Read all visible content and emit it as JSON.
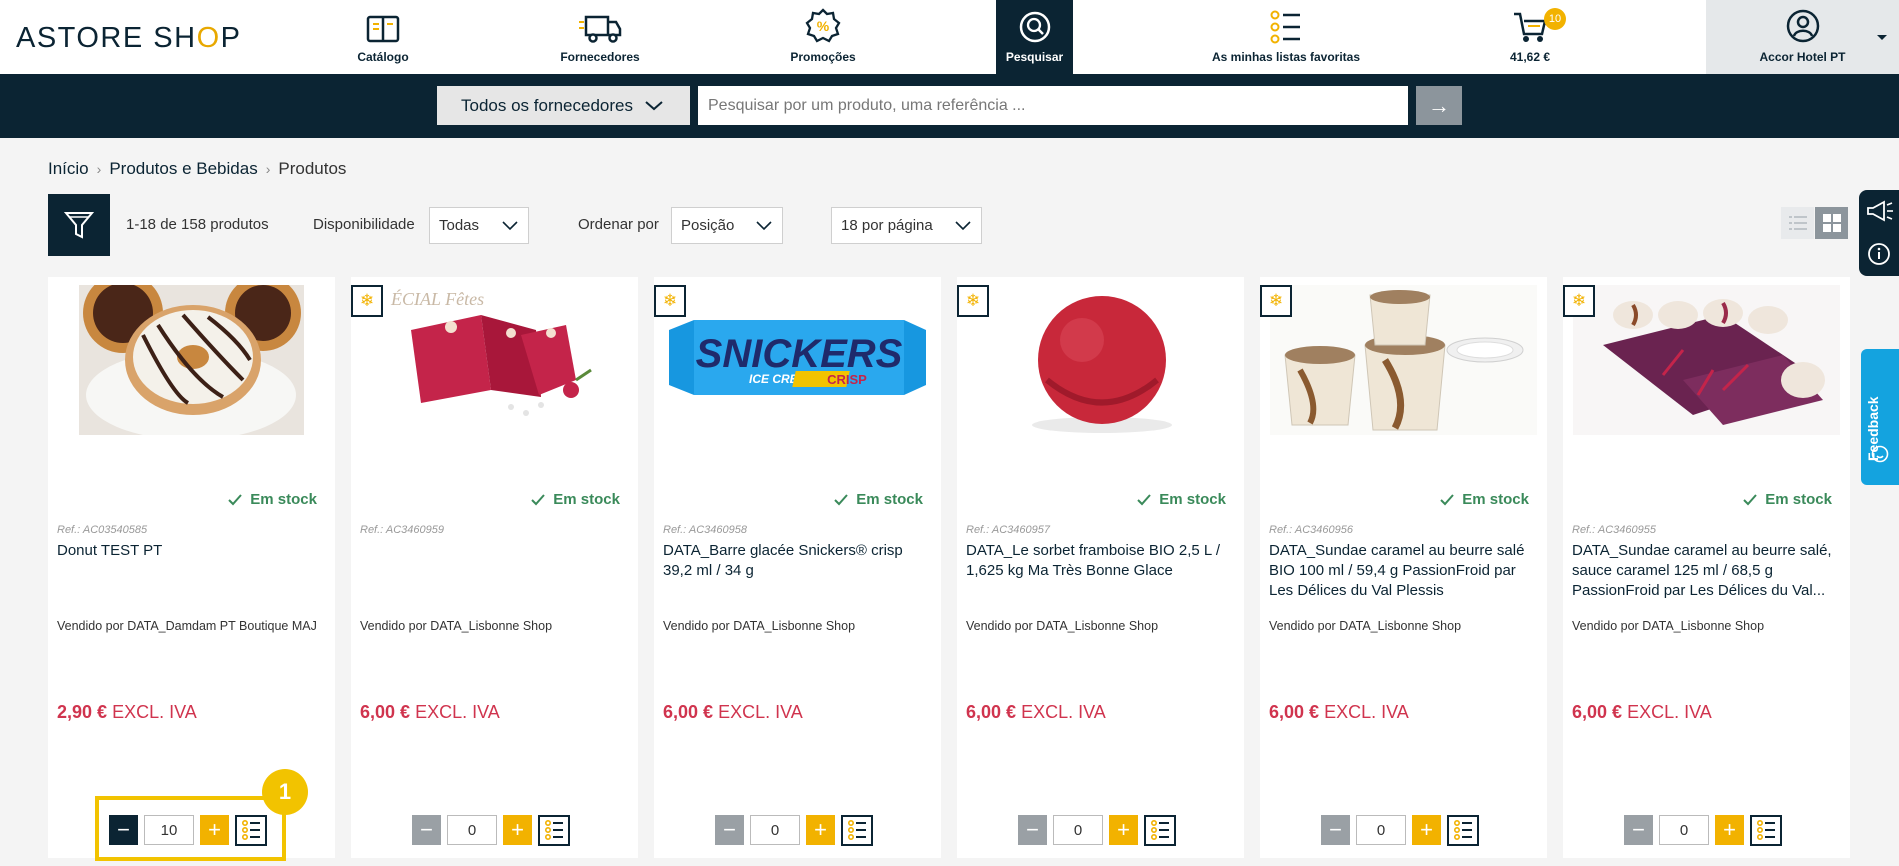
{
  "brand": {
    "logo_text_a": "ASTORE SH",
    "logo_text_o": "O",
    "logo_text_b": "P"
  },
  "nav": {
    "catalog": "Catálogo",
    "suppliers": "Fornecedores",
    "promotions": "Promoções",
    "search": "Pesquisar",
    "favorites": "As minhas listas favoritas",
    "cart_total": "41,62 €",
    "cart_count": "10",
    "account": "Accor Hotel PT"
  },
  "search": {
    "supplier_select": "Todos os fornecedores",
    "placeholder": "Pesquisar por um produto, uma referência ...",
    "go": "→"
  },
  "breadcrumb": {
    "home": "Início",
    "category": "Produtos e Bebidas",
    "current": "Produtos"
  },
  "toolbar": {
    "count": "1-18 de 158 produtos",
    "availability_label": "Disponibilidade",
    "availability_value": "Todas",
    "sort_label": "Ordenar por",
    "sort_value": "Posição",
    "per_page_value": "18 por página"
  },
  "feedback_label": "Feedback",
  "step_badge": "1",
  "products": [
    {
      "ref": "Ref.: AC03540585",
      "title": "Donut TEST PT",
      "seller": "Vendido por DATA_Damdam PT Boutique MAJ",
      "price": "2,90 €",
      "price_suffix": "EXCL. IVA",
      "stock": "Em stock",
      "qty": "10"
    },
    {
      "ref": "Ref.: AC3460959",
      "title": "",
      "seller": "Vendido por DATA_Lisbonne Shop",
      "price": "6,00 €",
      "price_suffix": "EXCL. IVA",
      "stock": "Em stock",
      "qty": "0"
    },
    {
      "ref": "Ref.: AC3460958",
      "title": "DATA_Barre glacée Snickers® crisp 39,2 ml / 34 g",
      "seller": "Vendido por DATA_Lisbonne Shop",
      "price": "6,00 €",
      "price_suffix": "EXCL. IVA",
      "stock": "Em stock",
      "qty": "0"
    },
    {
      "ref": "Ref.: AC3460957",
      "title": "DATA_Le sorbet framboise BIO 2,5 L / 1,625 kg Ma Très Bonne Glace",
      "seller": "Vendido por DATA_Lisbonne Shop",
      "price": "6,00 €",
      "price_suffix": "EXCL. IVA",
      "stock": "Em stock",
      "qty": "0"
    },
    {
      "ref": "Ref.: AC3460956",
      "title": "DATA_Sundae caramel au beurre salé BIO 100 ml / 59,4 g PassionFroid par Les Délices du Val Plessis",
      "seller": "Vendido por DATA_Lisbonne Shop",
      "price": "6,00 €",
      "price_suffix": "EXCL. IVA",
      "stock": "Em stock",
      "qty": "0"
    },
    {
      "ref": "Ref.: AC3460955",
      "title": "DATA_Sundae caramel au beurre salé, sauce caramel 125 ml / 68,5 g PassionFroid par Les Délices du Val...",
      "seller": "Vendido por DATA_Lisbonne Shop",
      "price": "6,00 €",
      "price_suffix": "EXCL. IVA",
      "stock": "Em stock",
      "qty": "0"
    }
  ],
  "product_image_text": {
    "snickers": "SNICKERS",
    "snickers_sub": "ICE CREAM",
    "snickers_crisp": "CRISP",
    "fetes": "ÉCIAL Fêtes"
  },
  "colors": {
    "navy": "#0b2433",
    "accent": "#f2b200",
    "price": "#d0344e",
    "stock": "#3a8a5a",
    "feedback": "#14a3df"
  }
}
